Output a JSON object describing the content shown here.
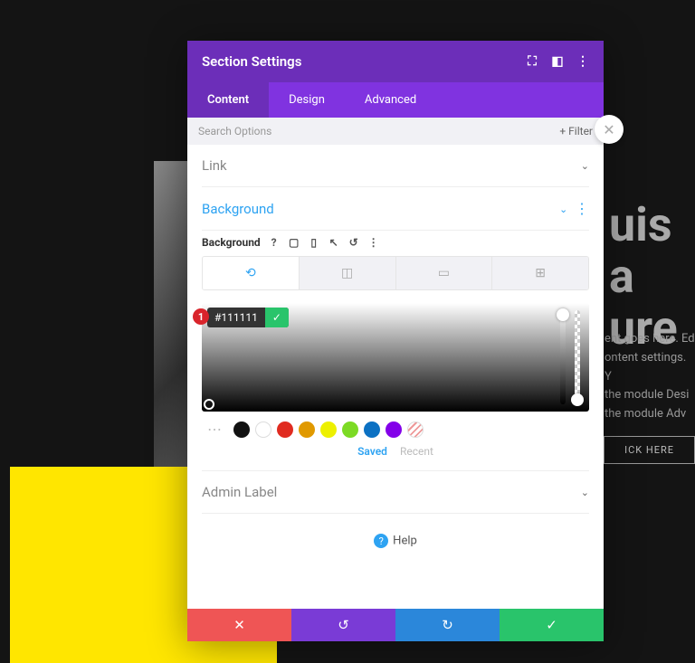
{
  "bg": {
    "heading_line1": "uis a",
    "heading_line2": "ure",
    "para1": "ent goes here. Ed",
    "para2": "ontent settings. Y",
    "para3": "the module Desi",
    "para4": "the module Adv",
    "button": "ICK HERE"
  },
  "modal": {
    "title": "Section Settings",
    "tabs": {
      "content": "Content",
      "design": "Design",
      "advanced": "Advanced"
    },
    "search_placeholder": "Search Options",
    "filter": "Filter",
    "sections": {
      "link": "Link",
      "background": "Background",
      "admin_label": "Admin Label"
    },
    "bg_label": "Background",
    "marker": "1",
    "hex": "#111111",
    "swatch_tabs": {
      "saved": "Saved",
      "recent": "Recent"
    },
    "help": "Help",
    "swatches": [
      {
        "name": "black",
        "c": "#111111"
      },
      {
        "name": "white",
        "c": "#ffffff",
        "outlined": true
      },
      {
        "name": "red",
        "c": "#e02b20"
      },
      {
        "name": "orange",
        "c": "#e09900"
      },
      {
        "name": "yellow",
        "c": "#edf000"
      },
      {
        "name": "green",
        "c": "#7cda24"
      },
      {
        "name": "blue",
        "c": "#0c71c3"
      },
      {
        "name": "violet",
        "c": "#8300e9"
      },
      {
        "name": "clear",
        "striped": true
      }
    ]
  }
}
